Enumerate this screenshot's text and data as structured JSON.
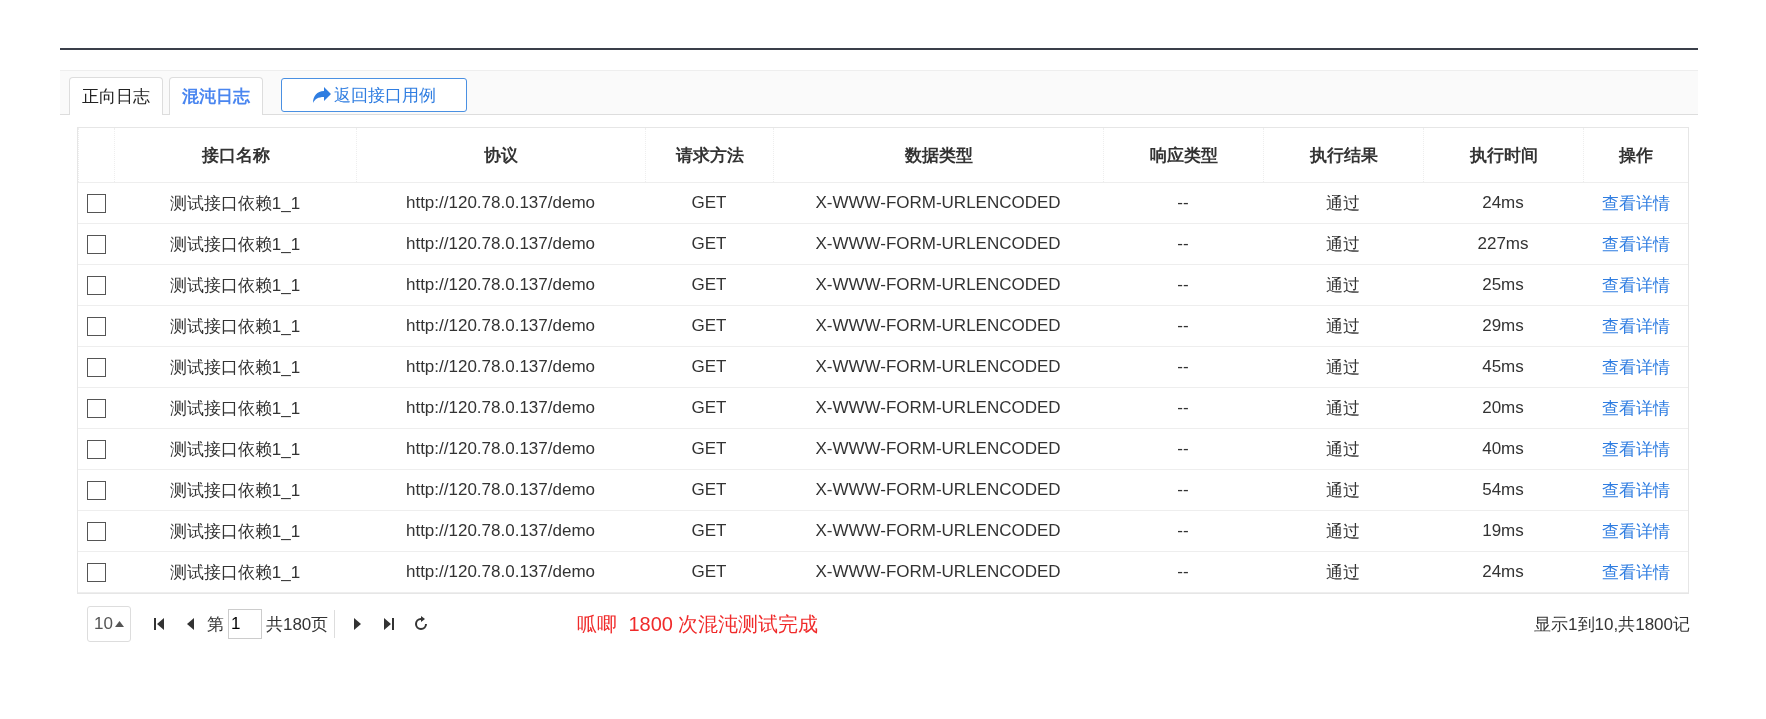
{
  "tabs": [
    {
      "label": "正向日志",
      "selected": false
    },
    {
      "label": "混沌日志",
      "selected": true
    }
  ],
  "back_button": {
    "label": "返回接口用例"
  },
  "table": {
    "columns": [
      "接口名称",
      "协议",
      "请求方法",
      "数据类型",
      "响应类型",
      "执行结果",
      "执行时间",
      "操作"
    ],
    "rows": [
      {
        "checked": false,
        "cells": [
          "测试接口依赖1_1",
          "http://120.78.0.137/demo",
          "GET",
          "X-WWW-FORM-URLENCODED",
          "--",
          "通过",
          "24ms"
        ],
        "action": "查看详情"
      },
      {
        "checked": false,
        "cells": [
          "测试接口依赖1_1",
          "http://120.78.0.137/demo",
          "GET",
          "X-WWW-FORM-URLENCODED",
          "--",
          "通过",
          "227ms"
        ],
        "action": "查看详情"
      },
      {
        "checked": false,
        "cells": [
          "测试接口依赖1_1",
          "http://120.78.0.137/demo",
          "GET",
          "X-WWW-FORM-URLENCODED",
          "--",
          "通过",
          "25ms"
        ],
        "action": "查看详情"
      },
      {
        "checked": false,
        "cells": [
          "测试接口依赖1_1",
          "http://120.78.0.137/demo",
          "GET",
          "X-WWW-FORM-URLENCODED",
          "--",
          "通过",
          "29ms"
        ],
        "action": "查看详情"
      },
      {
        "checked": false,
        "cells": [
          "测试接口依赖1_1",
          "http://120.78.0.137/demo",
          "GET",
          "X-WWW-FORM-URLENCODED",
          "--",
          "通过",
          "45ms"
        ],
        "action": "查看详情"
      },
      {
        "checked": false,
        "cells": [
          "测试接口依赖1_1",
          "http://120.78.0.137/demo",
          "GET",
          "X-WWW-FORM-URLENCODED",
          "--",
          "通过",
          "20ms"
        ],
        "action": "查看详情"
      },
      {
        "checked": false,
        "cells": [
          "测试接口依赖1_1",
          "http://120.78.0.137/demo",
          "GET",
          "X-WWW-FORM-URLENCODED",
          "--",
          "通过",
          "40ms"
        ],
        "action": "查看详情"
      },
      {
        "checked": false,
        "cells": [
          "测试接口依赖1_1",
          "http://120.78.0.137/demo",
          "GET",
          "X-WWW-FORM-URLENCODED",
          "--",
          "通过",
          "54ms"
        ],
        "action": "查看详情"
      },
      {
        "checked": false,
        "cells": [
          "测试接口依赖1_1",
          "http://120.78.0.137/demo",
          "GET",
          "X-WWW-FORM-URLENCODED",
          "--",
          "通过",
          "19ms"
        ],
        "action": "查看详情"
      },
      {
        "checked": false,
        "cells": [
          "测试接口依赖1_1",
          "http://120.78.0.137/demo",
          "GET",
          "X-WWW-FORM-URLENCODED",
          "--",
          "通过",
          "24ms"
        ],
        "action": "查看详情"
      }
    ]
  },
  "pagination": {
    "page_size": "10",
    "page_prefix": "第",
    "page": "1",
    "page_total": "共180页",
    "message": "呱唧  1800 次混沌测试完成",
    "summary": "显示1到10,共1800记"
  }
}
